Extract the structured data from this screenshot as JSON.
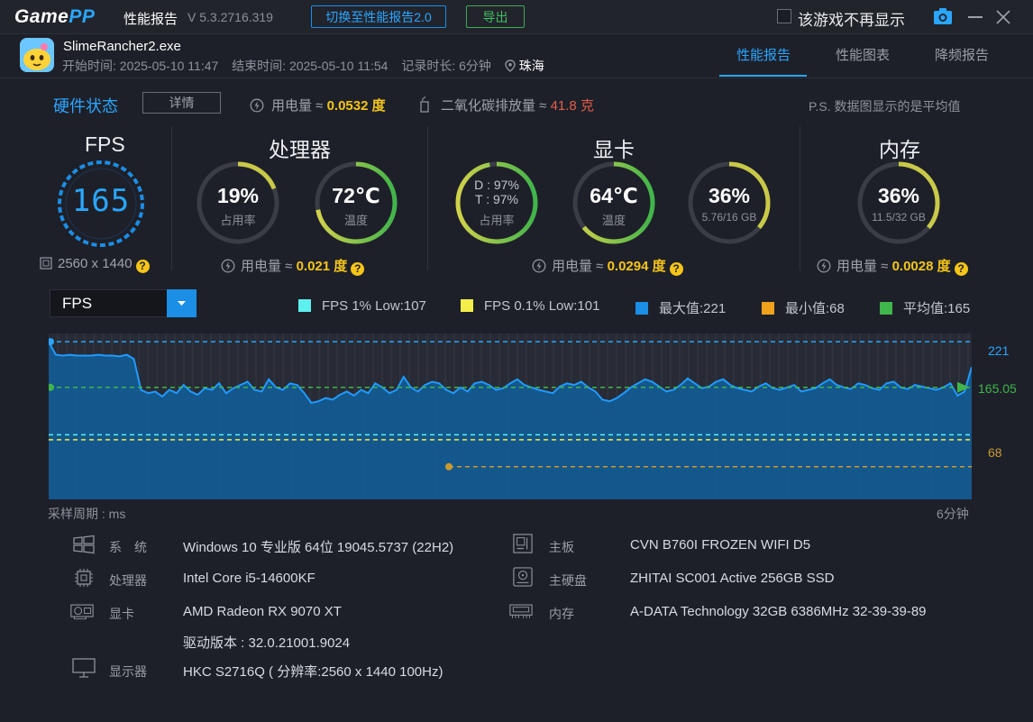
{
  "titlebar": {
    "logo_a": "Game",
    "logo_b": "PP",
    "title": "性能报告",
    "version": "V 5.3.2716.319",
    "switch_btn": "切换至性能报告2.0",
    "export_btn": "导出",
    "hide_label": "该游戏不再显示"
  },
  "game": {
    "name": "SlimeRancher2.exe",
    "start": "开始时间: 2025-05-10 11:47",
    "end": "结束时间: 2025-05-10 11:54",
    "duration": "记录时长: 6分钟",
    "location": "珠海"
  },
  "tabs": [
    "性能报告",
    "性能图表",
    "降频报告"
  ],
  "hw": {
    "title": "硬件状态",
    "detail_btn": "详情",
    "power_label": "用电量 ≈ ",
    "power_value": "0.0532 度",
    "co2_label": "二氧化碳排放量 ≈ ",
    "co2_value": "41.8 克",
    "note": "P.S. 数据图显示的是平均值"
  },
  "fps": {
    "title": "FPS",
    "value": "165",
    "resolution": "2560 x 1440"
  },
  "cpu": {
    "title": "处理器",
    "usage": "19%",
    "usage_label": "占用率",
    "usage_frac": 0.19,
    "temp": "72℃",
    "temp_label": "温度",
    "temp_frac": 0.72,
    "power_label": "用电量 ≈ ",
    "power_value": "0.021 度"
  },
  "gpu": {
    "title": "显卡",
    "d": "D : 97%",
    "t": "T : 97%",
    "usage_label": "占用率",
    "usage_frac": 0.97,
    "temp": "64℃",
    "temp_label": "温度",
    "temp_frac": 0.64,
    "vram": "36%",
    "vram_sub": "5.76/16 GB",
    "vram_frac": 0.36,
    "power_label": "用电量 ≈ ",
    "power_value": "0.0294 度"
  },
  "mem": {
    "title": "内存",
    "usage": "36%",
    "usage_sub": "11.5/32 GB",
    "usage_frac": 0.36,
    "power_label": "用电量 ≈ ",
    "power_value": "0.0028 度"
  },
  "chart_controls": {
    "metric": "FPS",
    "legend": [
      {
        "label": "FPS 1% Low:107",
        "color": "#5ef0ee"
      },
      {
        "label": "FPS 0.1% Low:101",
        "color": "#f3ee4a"
      },
      {
        "label": "最大值:221",
        "color": "#1b8ee6"
      },
      {
        "label": "最小值:68",
        "color": "#f0a21c"
      },
      {
        "label": "平均值:165",
        "color": "#3fb54a"
      }
    ],
    "x_start_label": "采样周期 : ms",
    "x_end_label": "6分钟"
  },
  "chart_data": {
    "type": "area",
    "title": "",
    "xlabel": "采样周期 : ms",
    "ylabel": "",
    "x_range_label": [
      "",
      "6分钟"
    ],
    "ylim": [
      28,
      231
    ],
    "reference_lines": [
      {
        "label": "221",
        "value": 221,
        "color": "#2aa6ff"
      },
      {
        "label": "165.05",
        "value": 165.05,
        "color": "#3fb54a"
      },
      {
        "label": "68",
        "value": 68,
        "color": "#c89a30"
      },
      {
        "label": "",
        "value": 107,
        "color": "#5ef0ee"
      },
      {
        "label": "",
        "value": 101,
        "color": "#f3ee4a"
      }
    ],
    "series": [
      {
        "values": [
          221,
          205,
          204,
          205,
          204,
          204,
          204,
          205,
          204,
          204,
          203,
          205,
          200,
          162,
          158,
          160,
          154,
          162,
          158,
          168,
          160,
          156,
          164,
          162,
          170,
          158,
          164,
          168,
          172,
          162,
          160,
          175,
          165,
          162,
          170,
          168,
          158,
          146,
          148,
          152,
          150,
          156,
          160,
          155,
          162,
          158,
          170,
          165,
          158,
          162,
          178,
          165,
          160,
          168,
          172,
          170,
          162,
          158,
          165,
          160,
          170,
          172,
          168,
          162,
          164,
          170,
          175,
          168,
          165,
          162,
          160,
          158,
          166,
          170,
          168,
          172,
          165,
          160,
          150,
          148,
          152,
          158,
          165,
          170,
          175,
          172,
          166,
          160,
          162,
          168,
          176,
          170,
          164,
          166,
          172,
          175,
          168,
          164,
          162,
          160,
          166,
          170,
          164,
          162,
          165,
          168,
          160,
          162,
          164,
          170,
          175,
          168,
          165,
          163,
          170,
          168,
          164,
          162,
          170,
          172,
          165,
          163,
          168,
          166,
          164,
          162,
          165,
          170,
          155,
          160,
          190
        ]
      }
    ]
  },
  "sysinfo": {
    "left": [
      {
        "key": "系　统",
        "value": "Windows 10 专业版 64位 19045.5737 (22H2)"
      },
      {
        "key": "处理器",
        "value": "Intel Core i5-14600KF"
      },
      {
        "key": "显卡",
        "value": "AMD Radeon RX 9070 XT"
      },
      {
        "key": "",
        "value": "驱动版本 : 32.0.21001.9024"
      },
      {
        "key": "显示器",
        "value": "HKC S2716Q ( 分辨率:2560 x 1440 100Hz)"
      }
    ],
    "right": [
      {
        "key": "主板",
        "value": "CVN B760I FROZEN WIFI D5"
      },
      {
        "key": "主硬盘",
        "value": "ZHITAI SC001 Active 256GB SSD"
      },
      {
        "key": "内存",
        "value": "A-DATA Technology 32GB 6386MHz 32-39-39-89"
      }
    ]
  }
}
